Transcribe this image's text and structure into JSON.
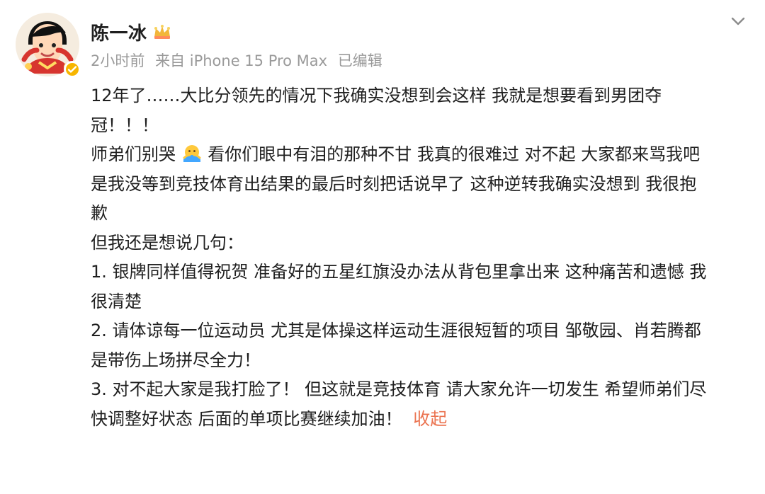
{
  "post": {
    "author": {
      "name": "陈一冰",
      "avatar_icon": "cartoon-avatar",
      "crown_icon": "crown-icon",
      "verified_icon": "verified-badge-icon"
    },
    "meta": {
      "time": "2小时前",
      "source": "来自 iPhone 15 Pro Max",
      "edited": "已编辑"
    },
    "header": {
      "menu_icon": "chevron-down-icon"
    },
    "content": {
      "line_01": "12年了……大比分领先的情况下我确实没想到会这样 我就是想要看到男团夺",
      "line_02": "冠！！！",
      "line_03_part_1": "师弟们别哭",
      "line_03_part_2": "看你们眼中有泪的那种不甘 我真的很难过 对不起 大家都来骂我吧",
      "line_04": "是我没等到竞技体育出结果的最后时刻把话说早了 这种逆转我确实没想到 我很抱",
      "line_05": "歉",
      "line_06": "但我还是想说几句：",
      "line_07": "1. 银牌同样值得祝贺 准备好的五星红旗没办法从背包里拿出来 这种痛苦和遗憾 我",
      "line_08": "很清楚",
      "line_09": "2. 请体谅每一位运动员 尤其是体操这样运动生涯很短暂的项目 邹敬园、肖若腾都",
      "line_10": "是带伤上场拼尽全力！",
      "line_11": "3. 对不起大家是我打脸了！ 但这就是竞技体育 请大家允许一切发生 希望师弟们尽",
      "line_12": "快调整好状态 后面的单项比赛继续加油！",
      "collapse_label": "收起",
      "emoji_icon": "hug-emoji-icon"
    },
    "colors": {
      "text": "#1f1f1f",
      "meta": "#9a9a9a",
      "accent": "#eb7350",
      "badge": "#f7b500",
      "crown": "#f2b63a"
    }
  }
}
